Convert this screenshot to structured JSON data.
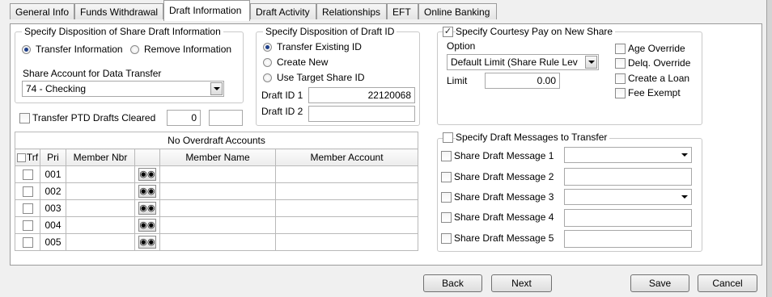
{
  "tabs": [
    {
      "label": "General Info"
    },
    {
      "label": "Funds Withdrawal"
    },
    {
      "label": "Draft Information"
    },
    {
      "label": "Draft Activity"
    },
    {
      "label": "Relationships"
    },
    {
      "label": "EFT"
    },
    {
      "label": "Online Banking"
    }
  ],
  "share_disposition": {
    "legend": "Specify Disposition of Share Draft Information",
    "transfer_label": "Transfer Information",
    "remove_label": "Remove Information",
    "selected": "transfer",
    "account_label": "Share Account for Data Transfer",
    "account_value": "74 - Checking"
  },
  "transfer_ptd": {
    "label": "Transfer PTD Drafts Cleared",
    "checked": false,
    "value1": "0",
    "value2": ""
  },
  "draft_id": {
    "legend": "Specify Disposition of Draft ID",
    "existing_label": "Transfer Existing ID",
    "new_label": "Create New",
    "target_label": "Use Target Share ID",
    "selected": "existing",
    "id1_label": "Draft ID 1",
    "id1_value": "22120068",
    "id2_label": "Draft ID 2",
    "id2_value": ""
  },
  "courtesy_pay": {
    "legend": "Specify Courtesy Pay on New Share",
    "checked": true,
    "option_label": "Option",
    "option_value": "Default Limit (Share Rule Lev",
    "limit_label": "Limit",
    "limit_value": "0.00",
    "age_override": "Age Override",
    "delq_override": "Delq. Override",
    "create_loan": "Create a Loan",
    "fee_exempt": "Fee Exempt"
  },
  "overdraft": {
    "caption": "No Overdraft Accounts",
    "headers": {
      "trf": "Trf",
      "pri": "Pri",
      "member_nbr": "Member Nbr",
      "member_name": "Member Name",
      "member_account": "Member Account"
    },
    "rows": [
      {
        "pri": "001",
        "member_nbr": "",
        "member_name": "",
        "member_account": ""
      },
      {
        "pri": "002",
        "member_nbr": "",
        "member_name": "",
        "member_account": ""
      },
      {
        "pri": "003",
        "member_nbr": "",
        "member_name": "",
        "member_account": ""
      },
      {
        "pri": "004",
        "member_nbr": "",
        "member_name": "",
        "member_account": ""
      },
      {
        "pri": "005",
        "member_nbr": "",
        "member_name": "",
        "member_account": ""
      }
    ]
  },
  "draft_messages": {
    "legend": "Specify Draft Messages to Transfer",
    "checked": false,
    "items": [
      {
        "label": "Share Draft Message 1",
        "value": ""
      },
      {
        "label": "Share Draft Message 2",
        "value": ""
      },
      {
        "label": "Share Draft Message 3",
        "value": ""
      },
      {
        "label": "Share Draft Message 4",
        "value": ""
      },
      {
        "label": "Share Draft Message 5",
        "value": ""
      }
    ]
  },
  "footer": {
    "back": "Back",
    "next": "Next",
    "save": "Save",
    "cancel": "Cancel"
  },
  "icons": {
    "lookup": "binoculars-icon",
    "dropdown": "chevron-down-icon"
  }
}
